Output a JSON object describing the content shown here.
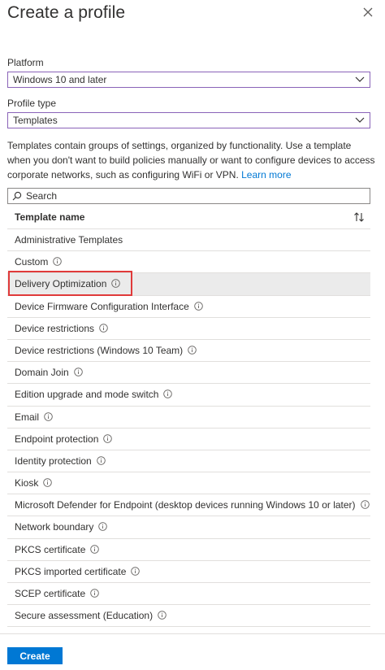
{
  "header": {
    "title": "Create a profile",
    "close_icon": "close-icon"
  },
  "platform": {
    "label": "Platform",
    "value": "Windows 10 and later"
  },
  "profile_type": {
    "label": "Profile type",
    "value": "Templates"
  },
  "description": {
    "text": "Templates contain groups of settings, organized by functionality. Use a template when you don't want to build policies manually or want to configure devices to access corporate networks, such as configuring WiFi or VPN.",
    "link": "Learn more"
  },
  "search": {
    "placeholder": "Search"
  },
  "table": {
    "column_header": "Template name",
    "rows": [
      {
        "name": "Administrative Templates",
        "info": false
      },
      {
        "name": "Custom",
        "info": true
      },
      {
        "name": "Delivery Optimization",
        "info": true,
        "selected": true
      },
      {
        "name": "Device Firmware Configuration Interface",
        "info": true
      },
      {
        "name": "Device restrictions",
        "info": true
      },
      {
        "name": "Device restrictions (Windows 10 Team)",
        "info": true
      },
      {
        "name": "Domain Join",
        "info": true
      },
      {
        "name": "Edition upgrade and mode switch",
        "info": true
      },
      {
        "name": "Email",
        "info": true
      },
      {
        "name": "Endpoint protection",
        "info": true
      },
      {
        "name": "Identity protection",
        "info": true
      },
      {
        "name": "Kiosk",
        "info": true
      },
      {
        "name": "Microsoft Defender for Endpoint (desktop devices running Windows 10 or later)",
        "info": true
      },
      {
        "name": "Network boundary",
        "info": true
      },
      {
        "name": "PKCS certificate",
        "info": true
      },
      {
        "name": "PKCS imported certificate",
        "info": true
      },
      {
        "name": "SCEP certificate",
        "info": true
      },
      {
        "name": "Secure assessment (Education)",
        "info": true
      }
    ]
  },
  "footer": {
    "create_label": "Create"
  },
  "colors": {
    "accent": "#0078d4",
    "focus_border": "#8a63b8",
    "highlight": "#e03a3a",
    "selected_row": "#ebebeb"
  }
}
